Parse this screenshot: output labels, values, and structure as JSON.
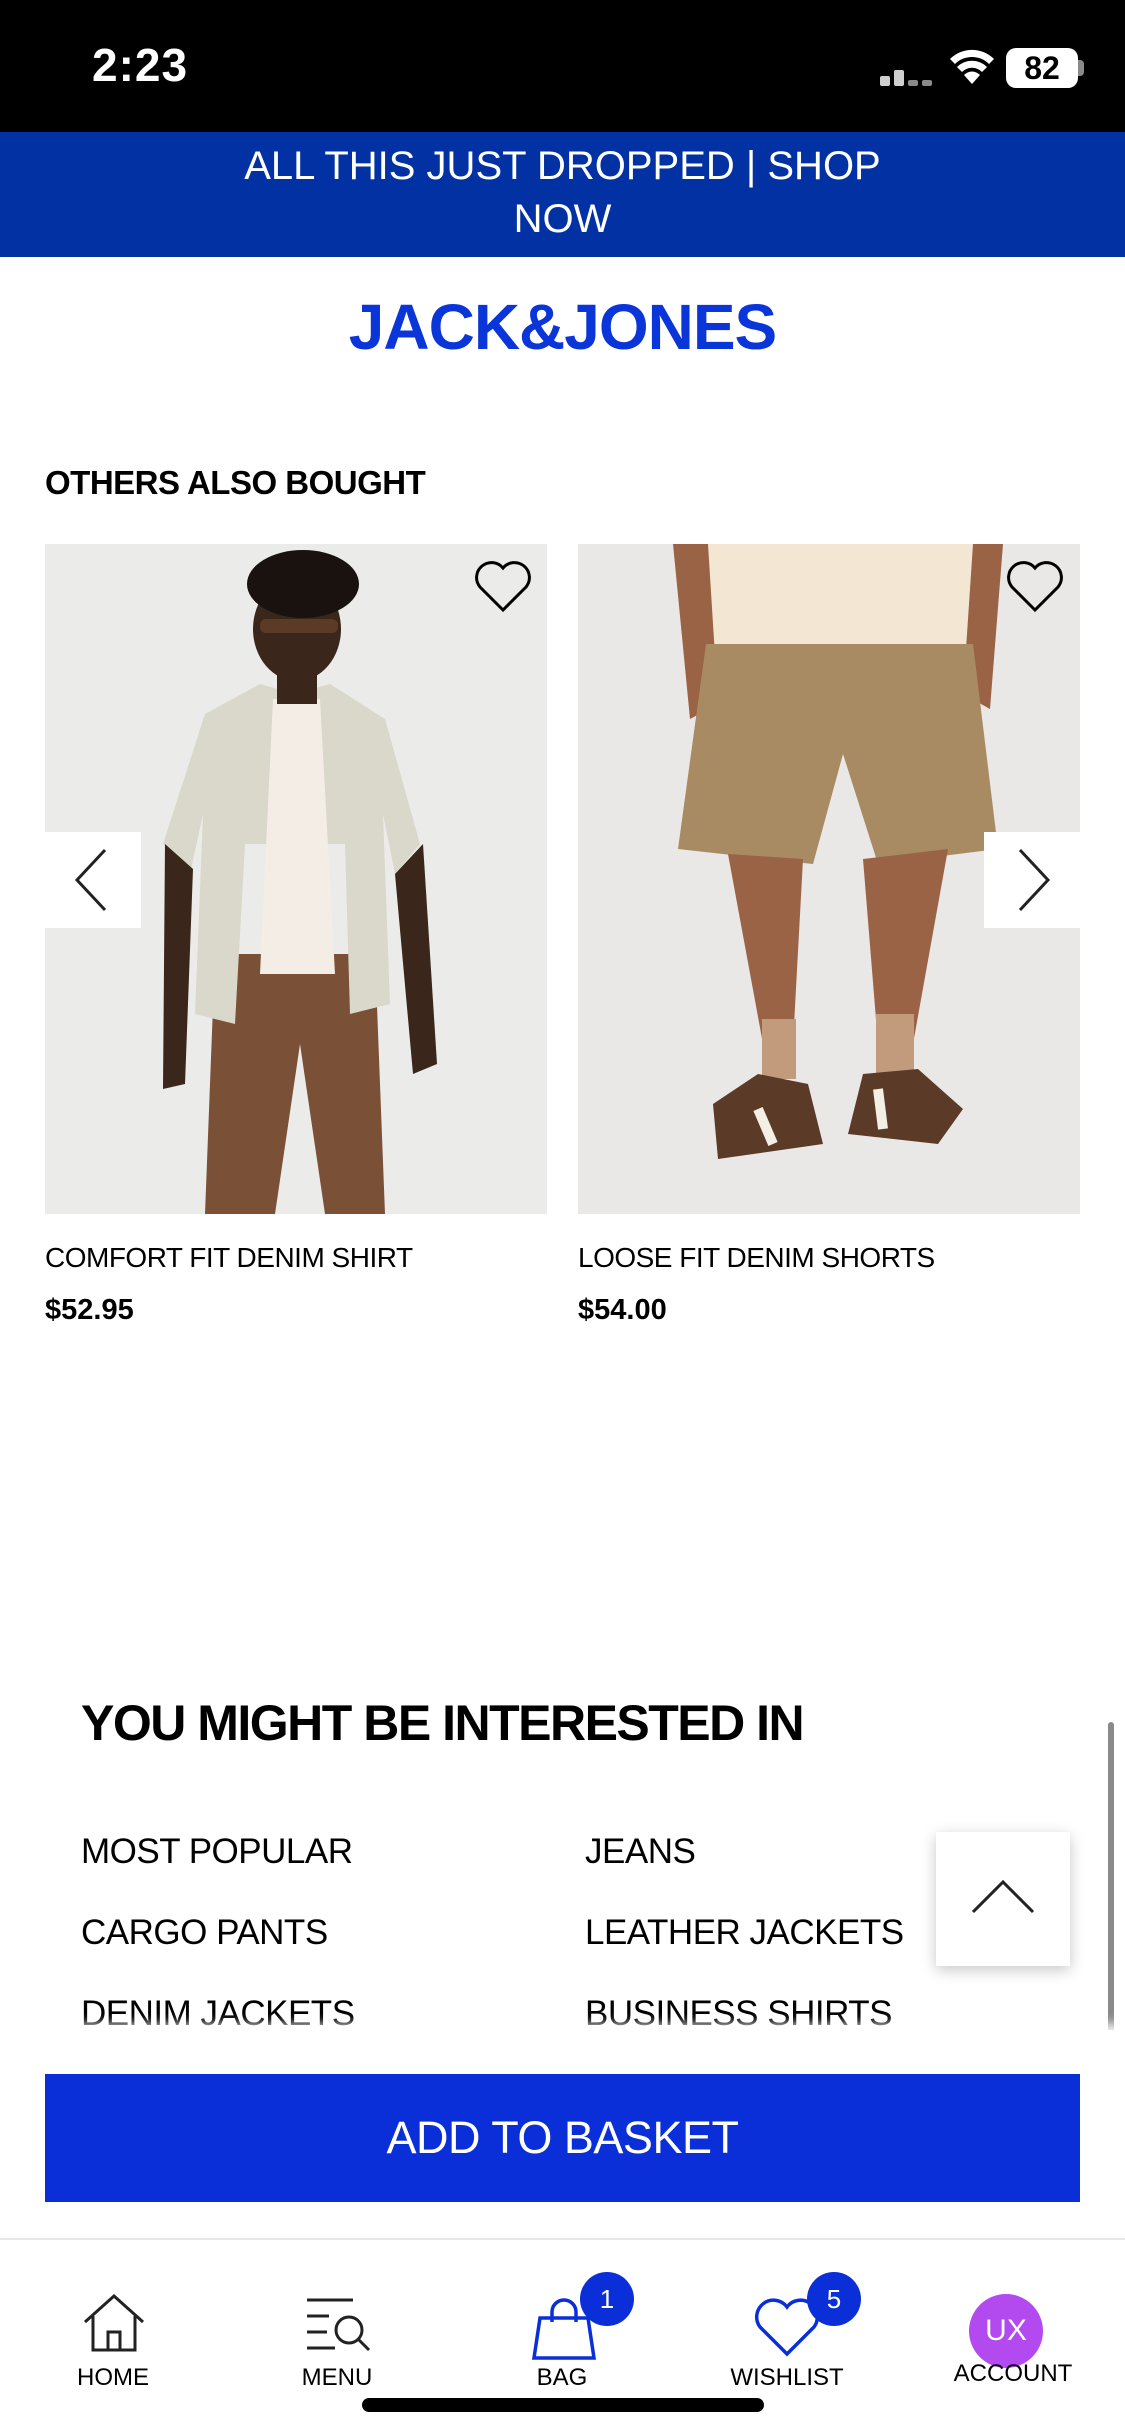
{
  "status_bar": {
    "time": "2:23",
    "battery": "82"
  },
  "promo_banner": {
    "text": "ALL THIS JUST DROPPED | SHOP NOW"
  },
  "brand": {
    "logo": "JACK&JONES",
    "color": "#0a35d8"
  },
  "others_also_bought": {
    "title": "OTHERS ALSO BOUGHT",
    "products": [
      {
        "name": "COMFORT FIT DENIM SHIRT",
        "price": "$52.95"
      },
      {
        "name": "LOOSE FIT DENIM SHORTS",
        "price": "$54.00"
      }
    ]
  },
  "interested": {
    "title": "YOU MIGHT BE INTERESTED IN",
    "links": [
      "MOST POPULAR",
      "JEANS",
      "CARGO PANTS",
      "LEATHER JACKETS",
      "DENIM JACKETS",
      "BUSINESS SHIRTS"
    ]
  },
  "actions": {
    "add_to_basket": "ADD TO BASKET"
  },
  "tab_bar": {
    "home": "HOME",
    "menu": "MENU",
    "bag": "BAG",
    "bag_count": "1",
    "wishlist": "WISHLIST",
    "wishlist_count": "5",
    "account": "ACCOUNT",
    "account_initials": "UX"
  },
  "colors": {
    "primary": "#0a2fd9",
    "banner": "#0131a3",
    "avatar": "#b34af0"
  },
  "icons": [
    "heart-icon",
    "chevron-left-icon",
    "chevron-right-icon",
    "chevron-up-icon",
    "home-icon",
    "menu-search-icon",
    "bag-icon",
    "wishlist-heart-icon"
  ]
}
